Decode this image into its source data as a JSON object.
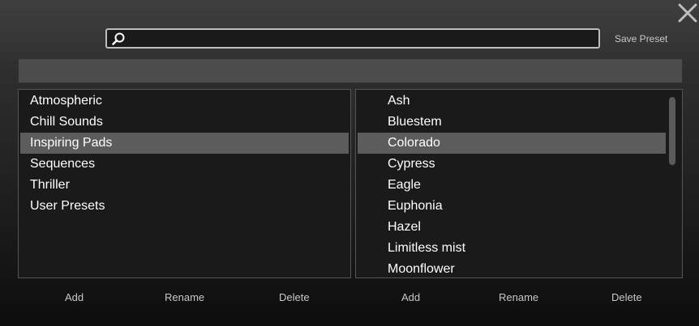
{
  "header": {
    "close_icon": "close-icon",
    "search": {
      "icon": "search-icon",
      "value": "",
      "placeholder": ""
    },
    "save_preset_label": "Save Preset"
  },
  "categories": {
    "items": [
      {
        "label": "Atmospheric"
      },
      {
        "label": "Chill Sounds"
      },
      {
        "label": "Inspiring Pads",
        "selected": true
      },
      {
        "label": "Sequences"
      },
      {
        "label": "Thriller"
      },
      {
        "label": "User Presets"
      }
    ],
    "buttons": {
      "add": "Add",
      "rename": "Rename",
      "delete": "Delete"
    }
  },
  "presets": {
    "items": [
      {
        "label": "Ash"
      },
      {
        "label": "Bluestem"
      },
      {
        "label": "Colorado",
        "selected": true
      },
      {
        "label": "Cypress"
      },
      {
        "label": "Eagle"
      },
      {
        "label": "Euphonia"
      },
      {
        "label": "Hazel"
      },
      {
        "label": "Limitless mist"
      },
      {
        "label": "Moonflower"
      }
    ],
    "buttons": {
      "add": "Add",
      "rename": "Rename",
      "delete": "Delete"
    }
  },
  "colors": {
    "selection": "#5c5c5c",
    "panel_background": "#1a1a1a",
    "text": "#ffffff",
    "button_text": "#c8c8c8"
  }
}
